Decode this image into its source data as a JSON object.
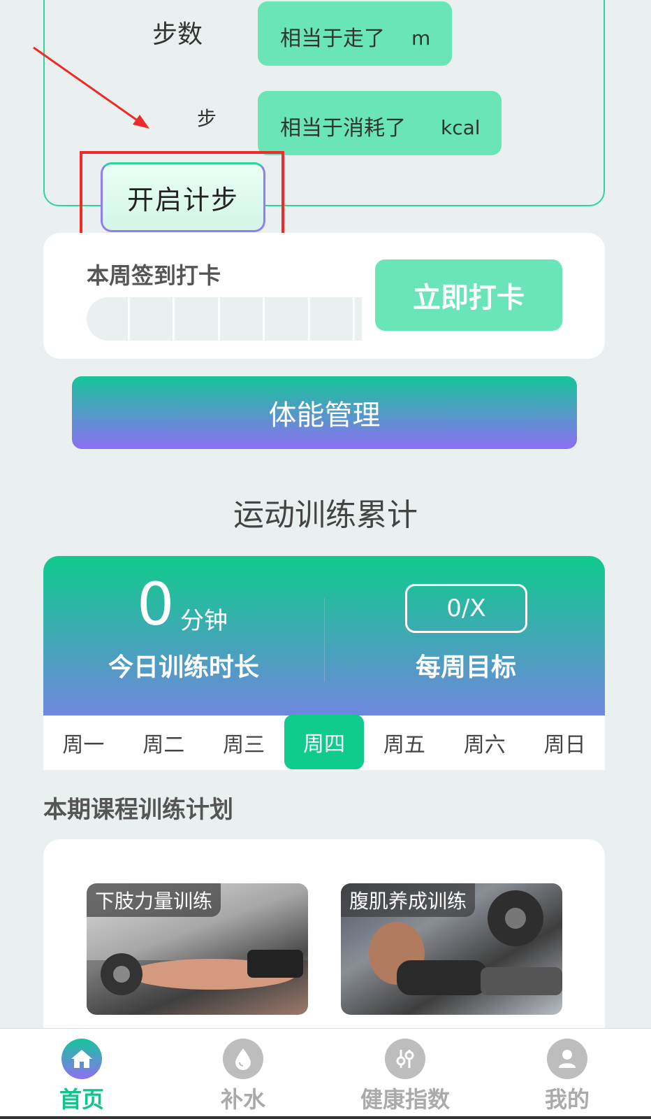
{
  "steps": {
    "label": "步数",
    "unit": "步",
    "distance_prefix": "相当于走了",
    "distance_unit": "m",
    "calorie_prefix": "相当于消耗了",
    "calorie_unit": "kcal",
    "start_button": "开启计步"
  },
  "checkin": {
    "title": "本周签到打卡",
    "button": "立即打卡"
  },
  "fitness_button": "体能管理",
  "training": {
    "section_title": "运动训练累计",
    "today_value": "0",
    "today_unit": "分钟",
    "today_label": "今日训练时长",
    "weekly_goal": "0/X",
    "weekly_label": "每周目标"
  },
  "week": {
    "days": [
      "周一",
      "周二",
      "周三",
      "周四",
      "周五",
      "周六",
      "周日"
    ],
    "active_day": "周四"
  },
  "plan": {
    "title": "本期课程训练计划",
    "courses": [
      {
        "label": "下肢力量训练"
      },
      {
        "label": "腹肌养成训练"
      }
    ]
  },
  "nav": {
    "items": [
      {
        "label": "首页",
        "icon": "home-icon",
        "active": true
      },
      {
        "label": "补水",
        "icon": "water-drop-icon",
        "active": false
      },
      {
        "label": "健康指数",
        "icon": "sliders-icon",
        "active": false
      },
      {
        "label": "我的",
        "icon": "user-icon",
        "active": false
      }
    ]
  },
  "colors": {
    "accent": "#0fcb8c",
    "mint": "#69e5b7",
    "purple": "#8d6ff2",
    "annotation_red": "#ee2a2a"
  }
}
